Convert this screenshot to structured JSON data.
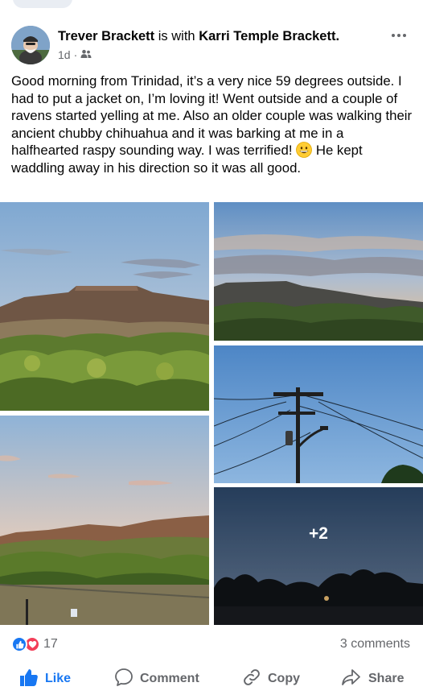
{
  "post": {
    "author": "Trever Brackett",
    "connector": "is with",
    "tagged": "Karri Temple Brackett.",
    "time": "1d",
    "separator": "·",
    "audience_icon": "friends-icon",
    "text_part1": "Good morning from Trinidad, it’s a very nice 59 degrees outside. I had to put a jacket on, I’m loving it! Went outside and a couple of ravens started yelling at me. Also an older couple was walking their ancient chubby chihuahua and it was barking at me in a halfhearted raspy sounding way. I was terrified! ",
    "text_part2": " He kept waddling away in his direction so it was all good.",
    "emoji": "grinning-face-emoji"
  },
  "photos": {
    "extra_count": "+2"
  },
  "engagement": {
    "reaction_count": "17",
    "comments": "3 comments"
  },
  "actions": {
    "like": "Like",
    "comment": "Comment",
    "copy": "Copy",
    "share": "Share"
  },
  "colors": {
    "brand_blue": "#1877f2",
    "love_red": "#f33e58",
    "muted_text": "#65676b"
  }
}
